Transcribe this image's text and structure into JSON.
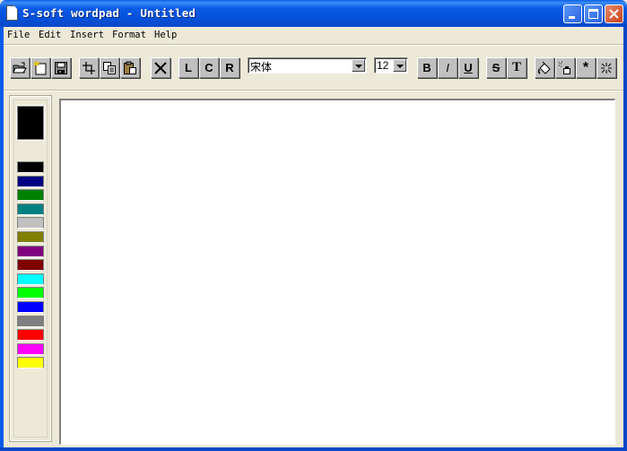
{
  "window": {
    "title": "S-soft wordpad - Untitled",
    "controls": {
      "minimize": "_",
      "maximize": "□",
      "close": "✕"
    }
  },
  "menu": [
    "File",
    "Edit",
    "Insert",
    "Format",
    "Help"
  ],
  "toolbar": {
    "file_buttons": [
      "open-icon",
      "new-icon",
      "save-icon"
    ],
    "edit_buttons": [
      "cut-icon",
      "copy-icon",
      "paste-icon"
    ],
    "delete_label": "✕",
    "align": {
      "left": "L",
      "center": "C",
      "right": "R"
    },
    "font_name": "宋体",
    "font_size": "12",
    "style": {
      "bold": "B",
      "italic": "I",
      "underline": "U",
      "strikeout": "S",
      "text": "T"
    },
    "extra_buttons": [
      "fill-color-icon",
      "spray-icon",
      "asterisk-label",
      "sparkle-icon"
    ],
    "asterisk_label": "*"
  },
  "palette": {
    "current_color": "#000000",
    "colors": [
      "#000000",
      "#000080",
      "#008000",
      "#008080",
      "#c0c0c0",
      "#808000",
      "#800080",
      "#800000",
      "#00ffff",
      "#00ff00",
      "#0000ff",
      "#808080",
      "#ff0000",
      "#ff00ff",
      "#ffff00"
    ]
  },
  "editor": {
    "content": ""
  }
}
